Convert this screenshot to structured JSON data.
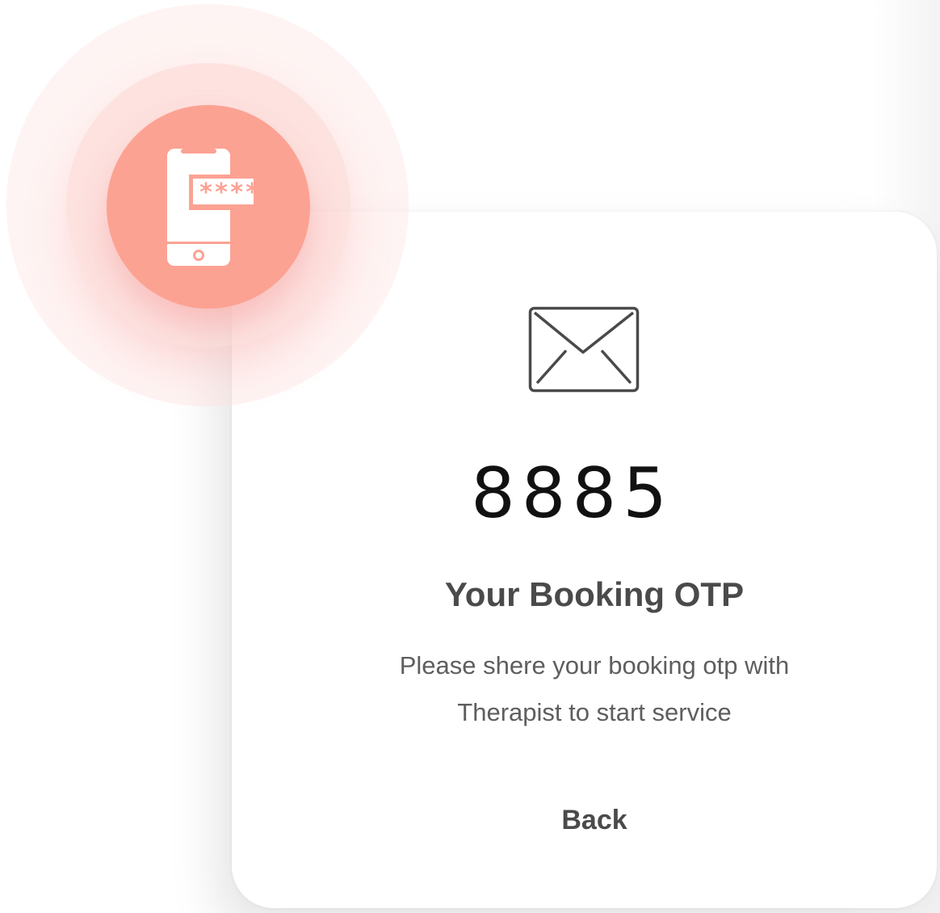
{
  "otp": {
    "code": "8885",
    "title": "Your Booking OTP",
    "description_line1": "Please shere your booking otp with",
    "description_line2": "Therapist to start service"
  },
  "actions": {
    "back_label": "Back"
  },
  "badge": {
    "icon": "phone-otp-icon",
    "masked_text": "****",
    "color": "#fca293"
  },
  "card": {
    "icon": "envelope-icon"
  }
}
